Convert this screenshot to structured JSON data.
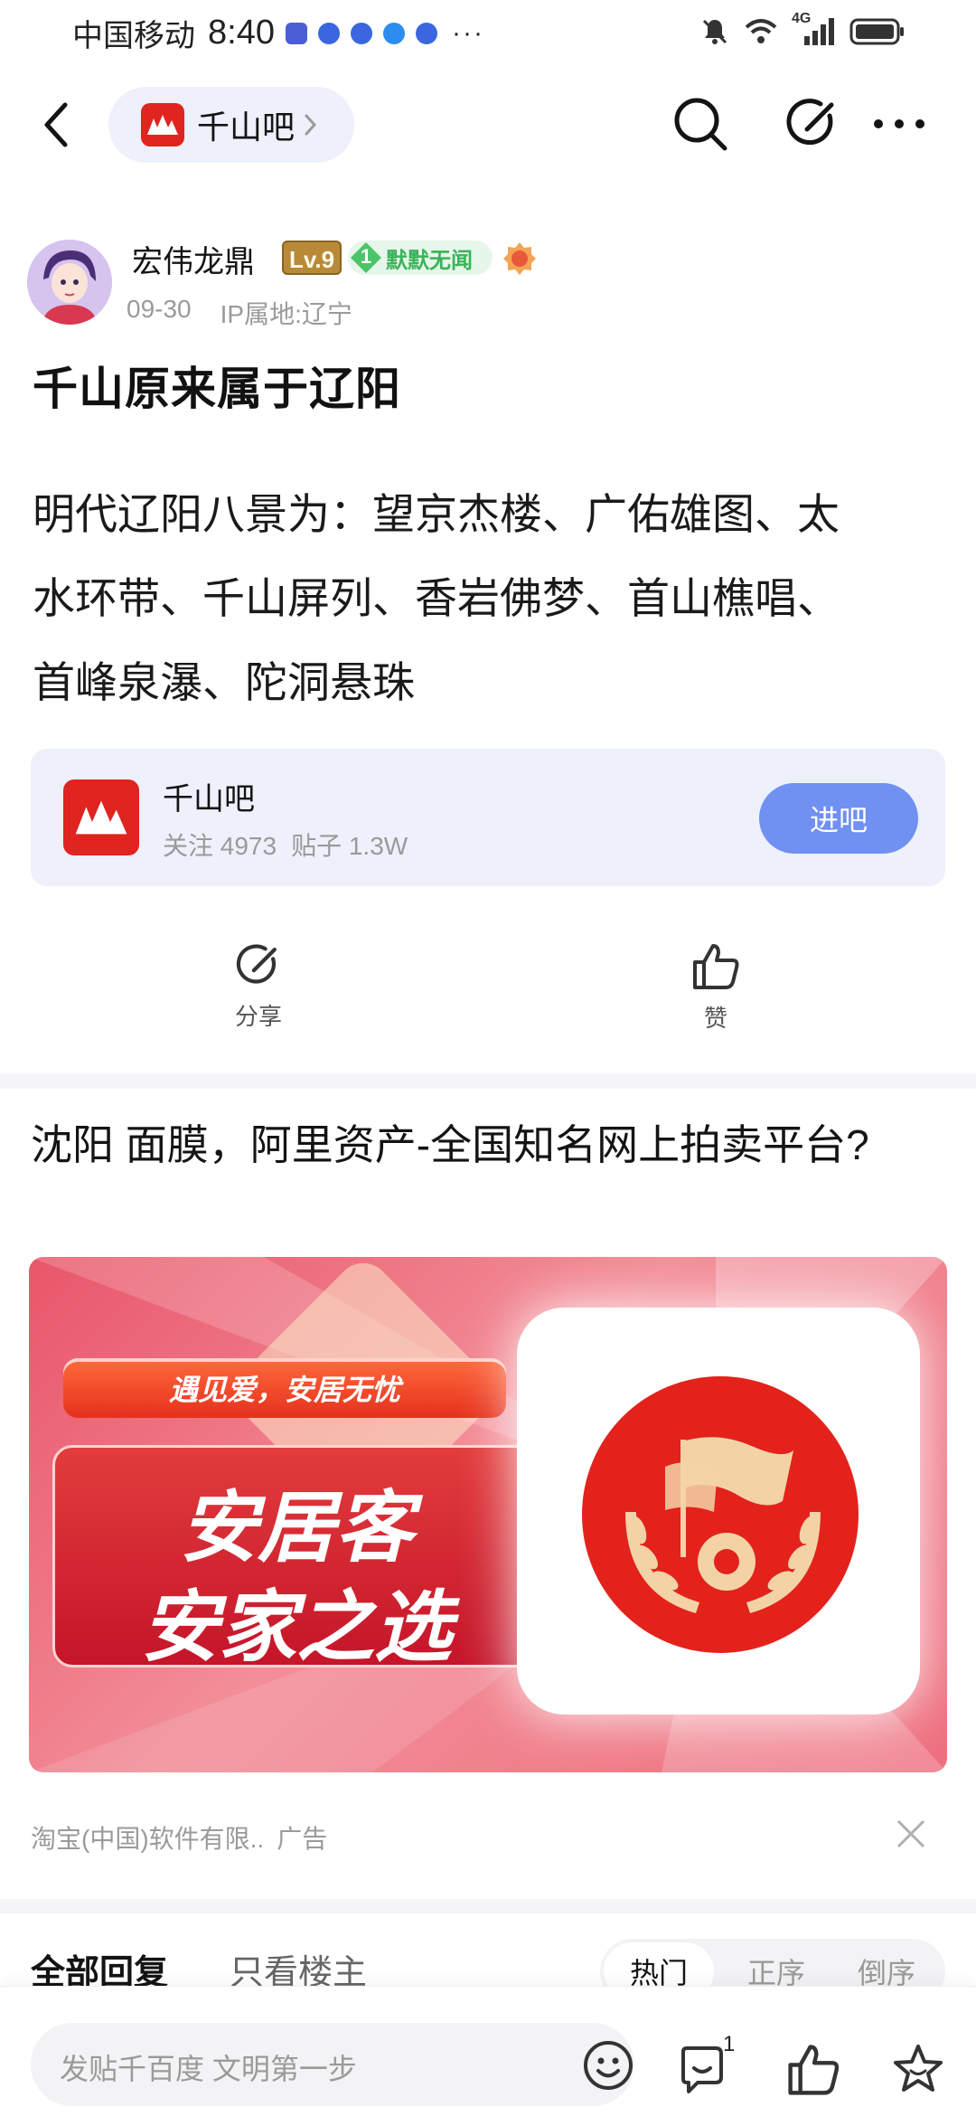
{
  "status_bar": {
    "carrier": "中国移动",
    "time": "8:40",
    "more": "···",
    "network": "4G"
  },
  "nav": {
    "forum_name": "千山吧"
  },
  "author": {
    "name": "宏伟龙鼎",
    "level": "Lv.9",
    "rank_number": "1",
    "rank_title": "默默无闻",
    "date": "09-30",
    "ip_location": "IP属地:辽宁"
  },
  "post": {
    "title": "千山原来属于辽阳",
    "body_lines": [
      "明代辽阳八景为：望京杰楼、广佑雄图、太",
      "水环带、千山屏列、香岩佛梦、首山樵唱、",
      "首峰泉瀑、陀洞悬珠"
    ]
  },
  "forum_card": {
    "name": "千山吧",
    "followers": "关注 4973",
    "posts": "贴子 1.3W",
    "join_label": "进吧"
  },
  "actions": {
    "share_label": "分享",
    "like_label": "赞"
  },
  "ad": {
    "title": "沈阳 面膜，阿里资产-全国知名网上拍卖平台?",
    "slogan": "遇见爱，安居无忧",
    "headline_1": "安居客",
    "headline_2": "安家之选",
    "source": "淘宝(中国)软件有限..",
    "ad_label": "广告"
  },
  "replies": {
    "tab_all": "全部回复",
    "tab_op": "只看楼主",
    "sort_hot": "热门",
    "sort_asc": "正序",
    "sort_desc": "倒序"
  },
  "bottom_bar": {
    "placeholder": "发贴千百度 文明第一步",
    "comment_count": "1"
  },
  "colors": {
    "accent": "#7090f2",
    "card_bg": "#eef0fb",
    "forum_logo": "#e0241f",
    "rank_green": "#3bb35a",
    "level_gold": "#b88a38"
  }
}
